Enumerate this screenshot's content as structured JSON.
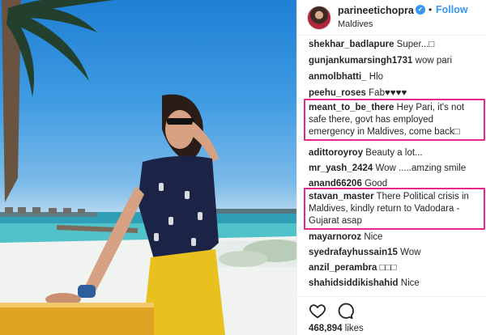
{
  "post": {
    "username": "parineetichopra",
    "verified_glyph": "✓",
    "separator": "•",
    "follow_label": "Follow",
    "location": "Maldives"
  },
  "comments": [
    {
      "user": "shekhar_badlapure",
      "text": "Super...□"
    },
    {
      "user": "gunjankumarsingh1731",
      "text": "wow pari"
    },
    {
      "user": "anmolbhatti_",
      "text": "Hlo"
    },
    {
      "user": "peehu_roses",
      "text": "Fab♥♥♥♥"
    },
    {
      "user": "meant_to_be_there",
      "text": "Hey Pari, it's not safe there, govt has employed emergency in Maldives, come back□",
      "highlighted": true
    },
    {
      "user": "adittoroyroy",
      "text": "Beauty a lot..."
    },
    {
      "user": "mr_yash_2424",
      "text": "Wow .....amzing smile"
    },
    {
      "user": "anand66206",
      "text": "Good"
    },
    {
      "user": "stavan_master",
      "text": "There Political crisis in Maldives, kindly return to Vadodara - Gujarat asap",
      "highlighted": true
    },
    {
      "user": "mayarnoroz",
      "text": "Nice"
    },
    {
      "user": "syedrafayhussain15",
      "text": "Wow"
    },
    {
      "user": "anzil_perambra",
      "text": "□□□"
    },
    {
      "user": "shahidsiddikishahid",
      "text": "Nice"
    }
  ],
  "actions": {
    "like_icon": "heart-icon",
    "comment_icon": "comment-icon",
    "likes_count": "468,894",
    "likes_label": "likes"
  },
  "colors": {
    "accent": "#3897f0",
    "highlight_border": "#e8268a",
    "text": "#262626"
  }
}
